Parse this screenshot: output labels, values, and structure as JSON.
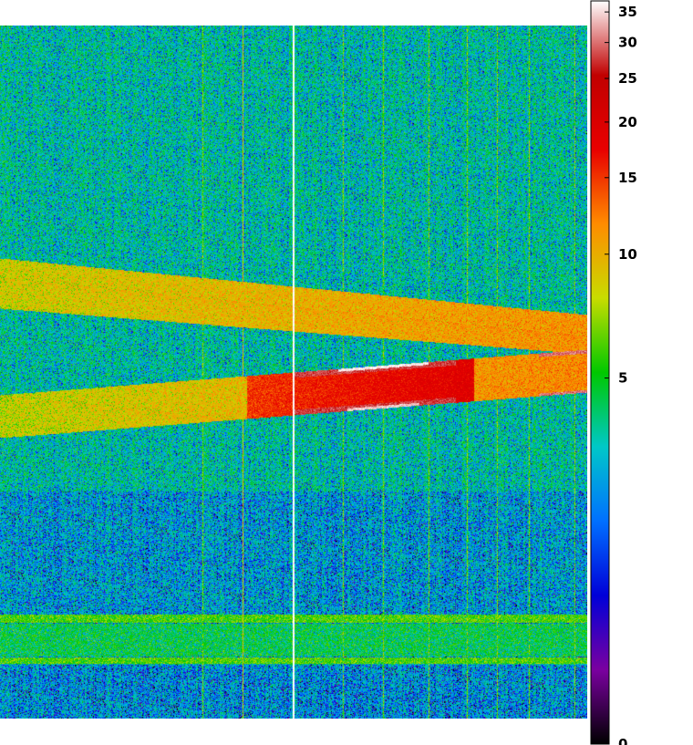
{
  "chart_data": {
    "type": "heatmap",
    "title": "",
    "xlabel": "",
    "ylabel": "",
    "colorbar": {
      "scale": "log",
      "range": [
        0,
        37
      ],
      "ticks": [
        {
          "value": 35,
          "label": "35"
        },
        {
          "value": 30,
          "label": "30"
        },
        {
          "value": 25,
          "label": "25"
        },
        {
          "value": 20,
          "label": "20"
        },
        {
          "value": 15,
          "label": "15"
        },
        {
          "value": 10,
          "label": "10"
        },
        {
          "value": 5,
          "label": "5"
        },
        {
          "value": 0,
          "label": "0"
        }
      ],
      "colors": [
        "#000000",
        "#7a00a0",
        "#0000d8",
        "#0070ff",
        "#00c8c8",
        "#00c800",
        "#c8dc00",
        "#ff8c00",
        "#e80000",
        "#c00000",
        "#ffffff"
      ]
    },
    "background_level": 3.5,
    "features": [
      {
        "name": "band-upper",
        "kind": "diagonal-band",
        "peak_value": 13
      },
      {
        "name": "band-lower",
        "kind": "diagonal-band",
        "peak_value": 36
      },
      {
        "name": "row-band",
        "kind": "horizontal-band",
        "peak_value": 6
      },
      {
        "name": "column-stripes",
        "kind": "vertical-lines",
        "peak_value": 38
      }
    ]
  }
}
